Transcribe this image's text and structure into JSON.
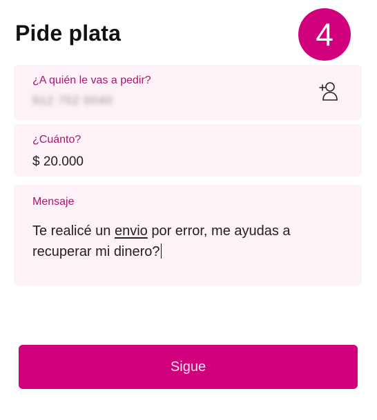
{
  "header": {
    "title": "Pide plata",
    "step_number": "4"
  },
  "form": {
    "recipient": {
      "label": "¿A quién le vas a pedir?",
      "value": "912 752 0040"
    },
    "amount": {
      "label": "¿Cuánto?",
      "value": "$ 20.000"
    },
    "message": {
      "label": "Mensaje",
      "text_part1": "Te realicé un ",
      "text_underlined": "envio",
      "text_part2": " por error, me ayudas a recuperar mi dinero?"
    }
  },
  "actions": {
    "continue_label": "Sigue"
  },
  "icons": {
    "contact_picker": "add-contact-icon"
  },
  "colors": {
    "accent": "#d1007d",
    "field_background": "#fdf2f8",
    "label": "#a5186c"
  }
}
